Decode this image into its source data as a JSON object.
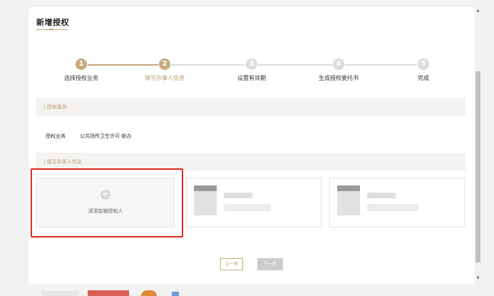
{
  "page": {
    "title": "新增授权"
  },
  "steps": [
    {
      "number": "1",
      "label": "选择授权业务",
      "state": "done"
    },
    {
      "number": "2",
      "label": "填写办事人信息",
      "state": "active"
    },
    {
      "number": "3",
      "label": "设置有效期",
      "state": "pending"
    },
    {
      "number": "4",
      "label": "生成授权委托书",
      "state": "pending"
    },
    {
      "number": "5",
      "label": "完成",
      "state": "pending"
    }
  ],
  "sections": {
    "service": {
      "title": "| 授权服务"
    },
    "agent": {
      "title": "| 填写办事人信息"
    }
  },
  "service": {
    "label": "授权业务",
    "value": "公共场所卫生许可-新办"
  },
  "add_card": {
    "icon": "+",
    "text": "请添加被授权人"
  },
  "buttons": {
    "prev": "上一步",
    "next": "下一步"
  },
  "colors": {
    "accent": "#c8a97e",
    "active_text": "#c0a074",
    "pending": "#dcdcdc",
    "highlight_border": "#e02a1f"
  }
}
